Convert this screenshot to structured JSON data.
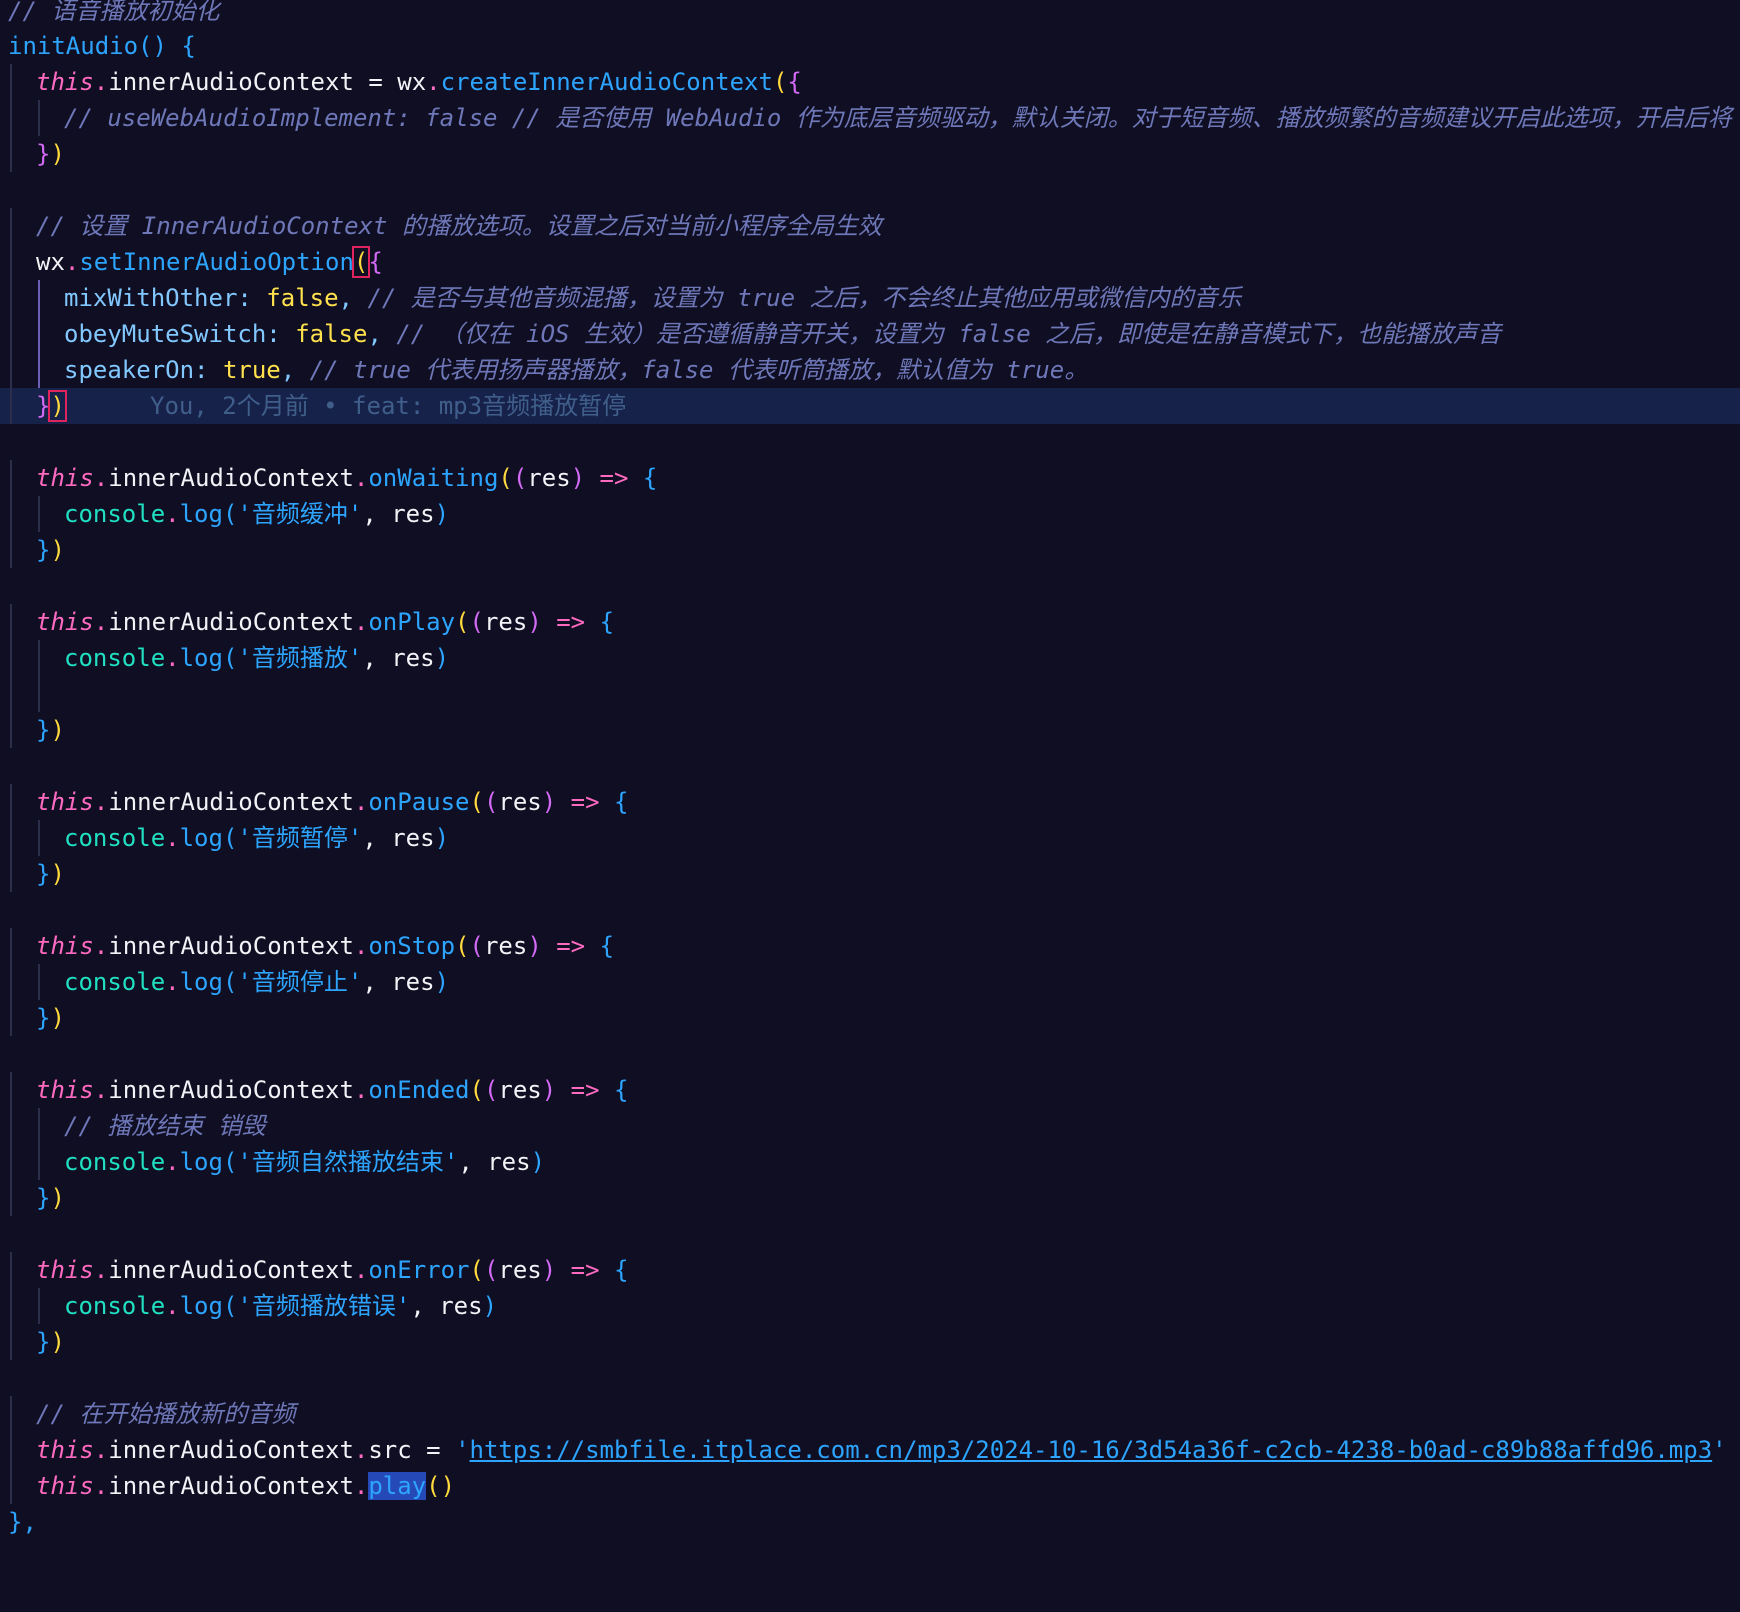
{
  "editor": {
    "blame_annotation": "You, 2个月前 • feat: mp3音频播放暂停",
    "comments": {
      "init": "// 语音播放初始化",
      "web_audio": "// useWebAudioImplement: false // 是否使用 WebAudio 作为底层音频驱动，默认关闭。对于短音频、播放频繁的音频建议开启此选项，开启后将",
      "set_option": "// 设置 InnerAudioContext 的播放选项。设置之后对当前小程序全局生效",
      "mix": "// 是否与其他音频混播，设置为 true 之后，不会终止其他应用或微信内的音乐",
      "obey": "// （仅在 iOS 生效）是否遵循静音开关，设置为 false 之后，即使是在静音模式下，也能播放声音",
      "speaker": "// true 代表用扬声器播放，false 代表听筒播放，默认值为 true。",
      "ended": "// 播放结束 销毁",
      "start": "// 在开始播放新的音频"
    },
    "idents": {
      "initAudio": "initAudio",
      "this": "this",
      "innerAudioContext": "innerAudioContext",
      "wx": "wx",
      "createInnerAudioContext": "createInnerAudioContext",
      "setInnerAudioOption": "setInnerAudioOption",
      "mixWithOther": "mixWithOther",
      "obeyMuteSwitch": "obeyMuteSwitch",
      "speakerOn": "speakerOn",
      "false": "false",
      "true": "true",
      "console": "console",
      "log": "log",
      "res": "res",
      "src": "src",
      "play": "play",
      "onWaiting": "onWaiting",
      "onPlay": "onPlay",
      "onPause": "onPause",
      "onStop": "onStop",
      "onEnded": "onEnded",
      "onError": "onError"
    },
    "strings": {
      "waiting": "'音频缓冲'",
      "play": "'音频播放'",
      "pause": "'音频暂停'",
      "stop": "'音频停止'",
      "ended": "'音频自然播放结束'",
      "error": "'音频播放错误'",
      "quote": "'",
      "url": "https://smbfile.itplace.com.cn/mp3/2024-10-16/3d54a36f-c2cb-4238-b0ad-c89b88affd96.mp3"
    }
  }
}
